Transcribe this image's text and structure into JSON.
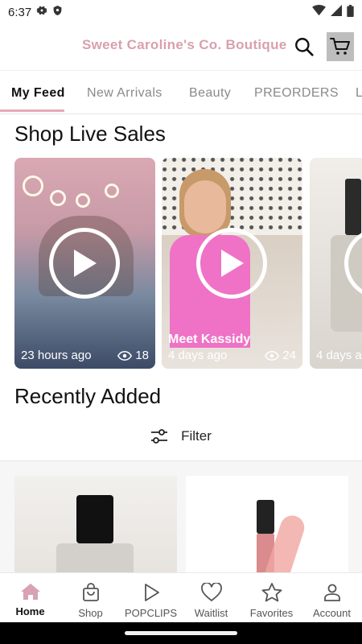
{
  "status_bar": {
    "time": "6:37"
  },
  "header": {
    "brand": "Sweet Caroline's Co. Boutique"
  },
  "tabs": [
    {
      "label": "My Feed",
      "active": true
    },
    {
      "label": "New Arrivals",
      "active": false
    },
    {
      "label": "Beauty",
      "active": false
    },
    {
      "label": "PREORDERS",
      "active": false
    },
    {
      "label": "L",
      "active": false
    }
  ],
  "live": {
    "title": "Shop Live Sales",
    "cards": [
      {
        "title": "",
        "time": "23 hours ago",
        "views": "18"
      },
      {
        "title": "Meet Kassidy",
        "time": "4 days ago",
        "views": "24"
      },
      {
        "title": "",
        "time": "4 days a",
        "views": ""
      }
    ]
  },
  "recent": {
    "title": "Recently Added",
    "filter_label": "Filter"
  },
  "nav": [
    {
      "label": "Home",
      "icon": "home-icon",
      "active": true
    },
    {
      "label": "Shop",
      "icon": "shopping-bag-icon",
      "active": false
    },
    {
      "label": "POPCLIPS",
      "icon": "play-icon",
      "active": false
    },
    {
      "label": "Waitlist",
      "icon": "heart-icon",
      "active": false
    },
    {
      "label": "Favorites",
      "icon": "star-icon",
      "active": false
    },
    {
      "label": "Account",
      "icon": "person-icon",
      "active": false
    }
  ],
  "colors": {
    "brand": "#d9a0ae",
    "tab_indicator": "#e7a9b8",
    "home_active": "#d8a2b1"
  }
}
